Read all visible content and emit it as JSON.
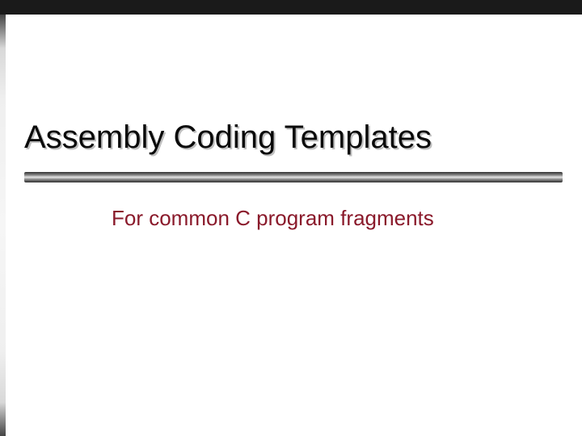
{
  "slide": {
    "title": "Assembly Coding Templates",
    "subtitle": "For common C program fragments"
  }
}
